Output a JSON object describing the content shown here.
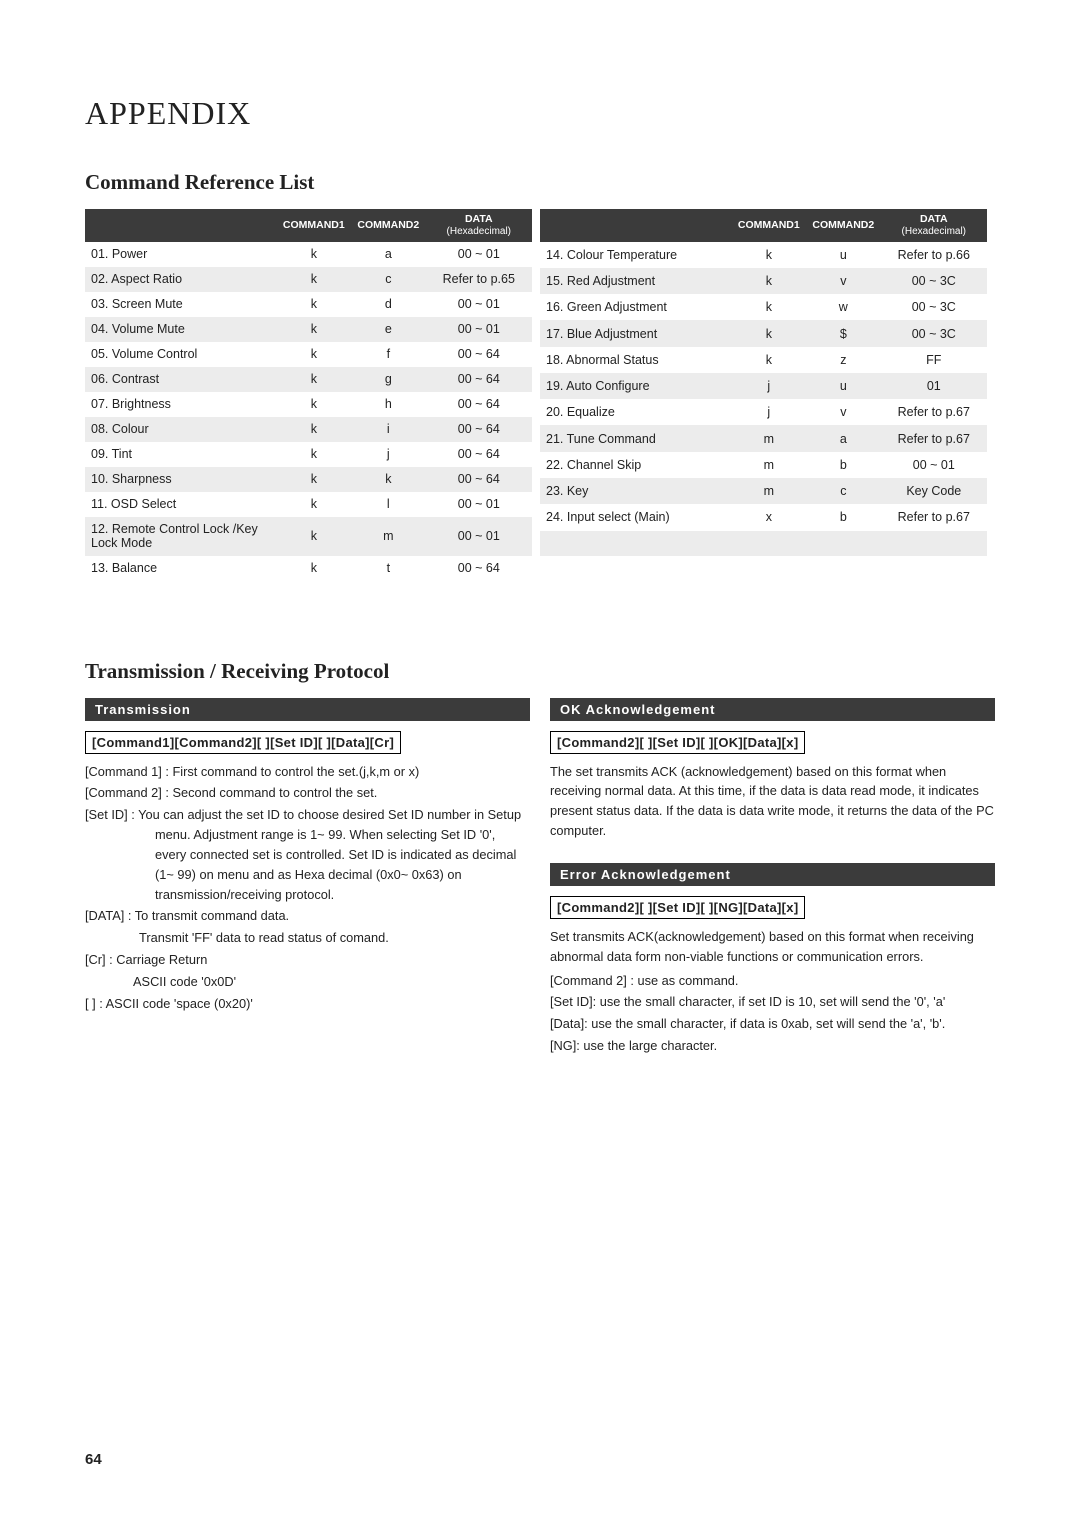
{
  "title": "APPENDIX",
  "section1": "Command Reference List",
  "headers": {
    "c1": "COMMAND1",
    "c2": "COMMAND2",
    "d1": "DATA",
    "d2": "(Hexadecimal)"
  },
  "left_rows": [
    {
      "name": "01. Power",
      "c1": "k",
      "c2": "a",
      "d": "00 ~ 01"
    },
    {
      "name": "02. Aspect Ratio",
      "c1": "k",
      "c2": "c",
      "d": "Refer to p.65"
    },
    {
      "name": "03. Screen Mute",
      "c1": "k",
      "c2": "d",
      "d": "00 ~ 01"
    },
    {
      "name": "04. Volume Mute",
      "c1": "k",
      "c2": "e",
      "d": "00 ~ 01"
    },
    {
      "name": "05. Volume Control",
      "c1": "k",
      "c2": "f",
      "d": "00 ~ 64"
    },
    {
      "name": "06. Contrast",
      "c1": "k",
      "c2": "g",
      "d": "00 ~ 64"
    },
    {
      "name": "07. Brightness",
      "c1": "k",
      "c2": "h",
      "d": "00 ~ 64"
    },
    {
      "name": "08. Colour",
      "c1": "k",
      "c2": "i",
      "d": "00 ~ 64"
    },
    {
      "name": "09. Tint",
      "c1": "k",
      "c2": "j",
      "d": "00 ~ 64"
    },
    {
      "name": "10. Sharpness",
      "c1": "k",
      "c2": "k",
      "d": "00 ~ 64"
    },
    {
      "name": "11. OSD Select",
      "c1": "k",
      "c2": "l",
      "d": "00 ~ 01"
    },
    {
      "name": "12. Remote Control Lock /Key Lock Mode",
      "c1": "k",
      "c2": "m",
      "d": "00 ~ 01"
    },
    {
      "name": "13. Balance",
      "c1": "k",
      "c2": "t",
      "d": "00 ~ 64"
    }
  ],
  "right_rows": [
    {
      "name": "14. Colour Temperature",
      "c1": "k",
      "c2": "u",
      "d": "Refer to p.66"
    },
    {
      "name": "15. Red Adjustment",
      "c1": "k",
      "c2": "v",
      "d": "00 ~ 3C"
    },
    {
      "name": "16. Green Adjustment",
      "c1": "k",
      "c2": "w",
      "d": "00 ~ 3C"
    },
    {
      "name": "17. Blue Adjustment",
      "c1": "k",
      "c2": "$",
      "d": "00 ~ 3C"
    },
    {
      "name": "18. Abnormal Status",
      "c1": "k",
      "c2": "z",
      "d": "FF"
    },
    {
      "name": "19. Auto Configure",
      "c1": "j",
      "c2": "u",
      "d": "01"
    },
    {
      "name": "20. Equalize",
      "c1": "j",
      "c2": "v",
      "d": "Refer to p.67"
    },
    {
      "name": "21. Tune Command",
      "c1": "m",
      "c2": "a",
      "d": "Refer to p.67"
    },
    {
      "name": "22. Channel Skip",
      "c1": "m",
      "c2": "b",
      "d": "00 ~ 01"
    },
    {
      "name": "23. Key",
      "c1": "m",
      "c2": "c",
      "d": "Key Code"
    },
    {
      "name": "24. Input select (Main)",
      "c1": "x",
      "c2": "b",
      "d": "Refer to p.67"
    }
  ],
  "section2": "Transmission / Receiving  Protocol",
  "bars": {
    "trans": "Transmission",
    "ok": "OK Acknowledgement",
    "err": "Error Acknowledgement"
  },
  "formats": {
    "trans": "[Command1][Command2][ ][Set ID][ ][Data][Cr]",
    "ok": "[Command2][ ][Set ID][ ][OK][Data][x]",
    "err": "[Command2][ ][Set ID][ ][NG][Data][x]"
  },
  "trans_body": {
    "l1": "[Command 1] : First command to control the set.(j,k,m or x)",
    "l2": "[Command 2] : Second command to control the set.",
    "l3": "[Set ID] : You can adjust the set ID to choose desired Set ID number in Setup menu. Adjustment range is 1~ 99. When selecting Set ID '0', every connected set is controlled. Set ID is indicated as decimal (1~ 99) on menu and as Hexa decimal (0x0~ 0x63) on transmission/receiving protocol.",
    "l4": "[DATA] : To transmit command data.",
    "l5": "Transmit 'FF' data to read status of comand.",
    "l6": "[Cr] : Carriage Return",
    "l7": "ASCII code '0x0D'",
    "l8": "[   ] : ASCII code 'space (0x20)'"
  },
  "ok_body": "The set transmits ACK (acknowledgement) based on this format when receiving normal data. At this time, if the data is data read mode, it indicates present status data. If the data is data write mode, it returns the data of the PC computer.",
  "err_body": {
    "p1": "Set transmits ACK(acknowledgement) based on this format when receiving abnormal data form non-viable functions or communication errors.",
    "p2": "[Command 2] : use as command.",
    "p3": "[Set ID]: use the small character, if set ID is 10, set will send the '0', 'a'",
    "p4": "[Data]: use the small character, if data is 0xab, set will send the 'a', 'b'.",
    "p5": "[NG]: use the large character."
  },
  "page": "64"
}
